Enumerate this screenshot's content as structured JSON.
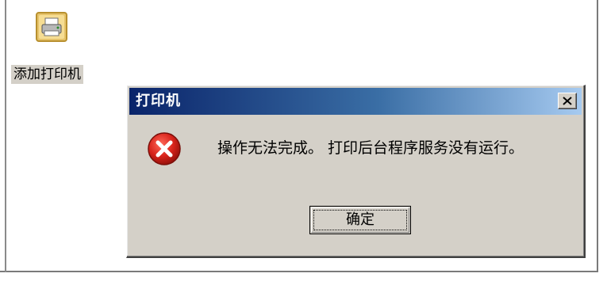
{
  "desktop": {
    "add_printer_label": "添加打印机",
    "add_printer_icon": "printer-icon"
  },
  "dialog": {
    "title": "打印机",
    "close_icon": "close-icon",
    "error_icon": "error-icon",
    "message": "操作无法完成。 打印后台程序服务没有运行。",
    "ok_label": "确定"
  },
  "colors": {
    "titlebar_start": "#0a246a",
    "titlebar_end": "#a6caf0",
    "dialog_face": "#d4d0c8",
    "error_red": "#d8231b",
    "icon_label_bg": "#d4d0c8"
  }
}
